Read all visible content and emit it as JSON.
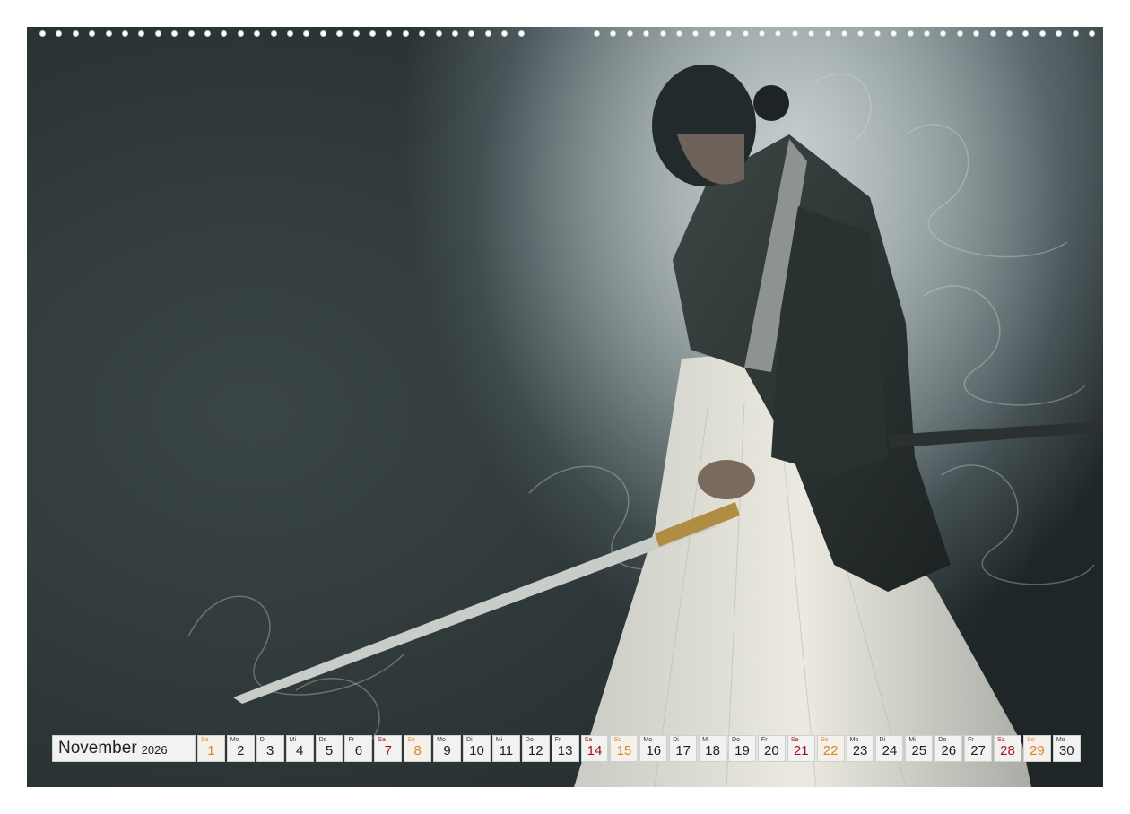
{
  "calendar": {
    "month": "November",
    "year": "2026",
    "days": [
      {
        "dow": "So",
        "num": "1",
        "type": "so"
      },
      {
        "dow": "Mo",
        "num": "2",
        "type": ""
      },
      {
        "dow": "Di",
        "num": "3",
        "type": ""
      },
      {
        "dow": "Mi",
        "num": "4",
        "type": ""
      },
      {
        "dow": "Do",
        "num": "5",
        "type": ""
      },
      {
        "dow": "Fr",
        "num": "6",
        "type": ""
      },
      {
        "dow": "Sa",
        "num": "7",
        "type": "sa"
      },
      {
        "dow": "So",
        "num": "8",
        "type": "so"
      },
      {
        "dow": "Mo",
        "num": "9",
        "type": ""
      },
      {
        "dow": "Di",
        "num": "10",
        "type": ""
      },
      {
        "dow": "Mi",
        "num": "11",
        "type": ""
      },
      {
        "dow": "Do",
        "num": "12",
        "type": ""
      },
      {
        "dow": "Fr",
        "num": "13",
        "type": ""
      },
      {
        "dow": "Sa",
        "num": "14",
        "type": "sa"
      },
      {
        "dow": "So",
        "num": "15",
        "type": "so"
      },
      {
        "dow": "Mo",
        "num": "16",
        "type": ""
      },
      {
        "dow": "Di",
        "num": "17",
        "type": ""
      },
      {
        "dow": "Mi",
        "num": "18",
        "type": ""
      },
      {
        "dow": "Do",
        "num": "19",
        "type": ""
      },
      {
        "dow": "Fr",
        "num": "20",
        "type": ""
      },
      {
        "dow": "Sa",
        "num": "21",
        "type": "sa"
      },
      {
        "dow": "So",
        "num": "22",
        "type": "so"
      },
      {
        "dow": "Mo",
        "num": "23",
        "type": ""
      },
      {
        "dow": "Di",
        "num": "24",
        "type": ""
      },
      {
        "dow": "Mi",
        "num": "25",
        "type": ""
      },
      {
        "dow": "Do",
        "num": "26",
        "type": ""
      },
      {
        "dow": "Fr",
        "num": "27",
        "type": ""
      },
      {
        "dow": "Sa",
        "num": "28",
        "type": "sa"
      },
      {
        "dow": "So",
        "num": "29",
        "type": "so"
      },
      {
        "dow": "Mo",
        "num": "30",
        "type": ""
      }
    ]
  },
  "colors": {
    "saturday": "#a31419",
    "sunday": "#e0821e",
    "cell_bg": "#f2f2f2"
  }
}
